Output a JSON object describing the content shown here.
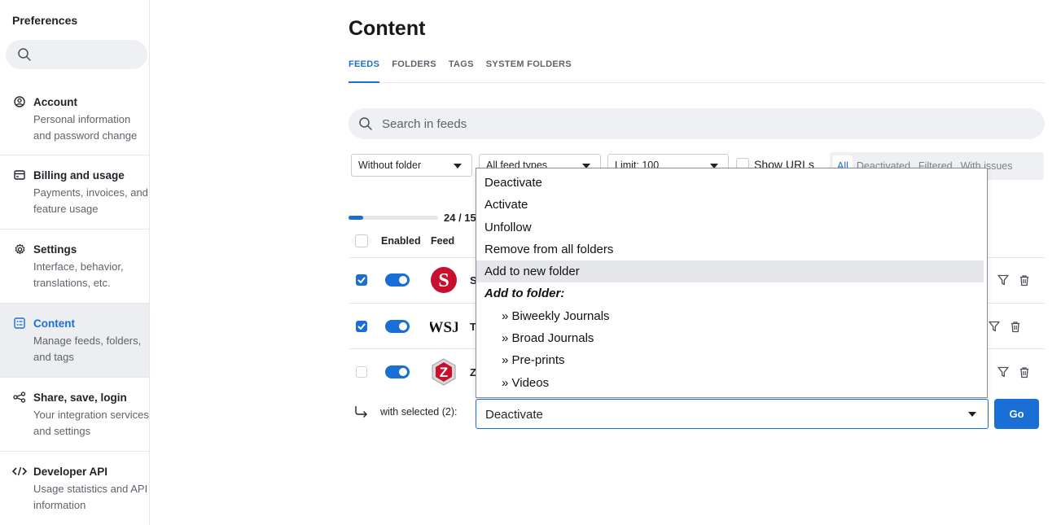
{
  "sidebar": {
    "title": "Preferences",
    "items": [
      {
        "label": "Account",
        "desc": "Personal information and password change",
        "icon": "account-circle-icon"
      },
      {
        "label": "Billing and usage",
        "desc": "Payments, invoices, and feature usage",
        "icon": "credit-card-icon"
      },
      {
        "label": "Settings",
        "desc": "Interface, behavior, translations, etc.",
        "icon": "gear-icon"
      },
      {
        "label": "Content",
        "desc": "Manage feeds, folders, and tags",
        "icon": "content-list-icon"
      },
      {
        "label": "Share, save, login",
        "desc": "Your integration services and settings",
        "icon": "share-icon"
      },
      {
        "label": "Developer API",
        "desc": "Usage statistics and API information",
        "icon": "code-icon"
      }
    ]
  },
  "main": {
    "title": "Content",
    "tabs": [
      {
        "label": "FEEDS",
        "active": true
      },
      {
        "label": "FOLDERS",
        "active": false
      },
      {
        "label": "TAGS",
        "active": false
      },
      {
        "label": "SYSTEM FOLDERS",
        "active": false
      }
    ],
    "search_placeholder": "Search in feeds",
    "filters": {
      "folder": "Without folder",
      "feed_types": "All feed types",
      "limit": "Limit: 100",
      "show_urls": "Show URLs",
      "segments": [
        "All",
        "Deactivated",
        "Filtered",
        "With issues"
      ],
      "active_segment": "All"
    },
    "progress": {
      "text": "24 / 15",
      "fraction": 0.16
    },
    "table": {
      "headers": {
        "enabled": "Enabled",
        "feed": "Feed"
      },
      "rows": [
        {
          "name": "S",
          "checked": true,
          "enabled": true,
          "logo": "S"
        },
        {
          "name": "T",
          "checked": true,
          "enabled": true,
          "logo": "WSJ"
        },
        {
          "name": "Z",
          "checked": false,
          "enabled": true,
          "logo": "Z"
        }
      ]
    },
    "bulk": {
      "with_selected": "with selected (2):",
      "selected_action": "Deactivate",
      "go": "Go"
    },
    "dropdown": {
      "items": [
        "Deactivate",
        "Activate",
        "Unfollow",
        "Remove from all folders",
        "Add to new folder"
      ],
      "highlighted": "Add to new folder",
      "group_label": "Add to folder:",
      "folders": [
        "» Biweekly Journals",
        "» Broad Journals",
        "» Pre-prints",
        "» Videos"
      ]
    }
  },
  "colors": {
    "accent": "#1a6fd6",
    "sidebar_active": "#eceef1",
    "logo_red": "#c8102e"
  }
}
